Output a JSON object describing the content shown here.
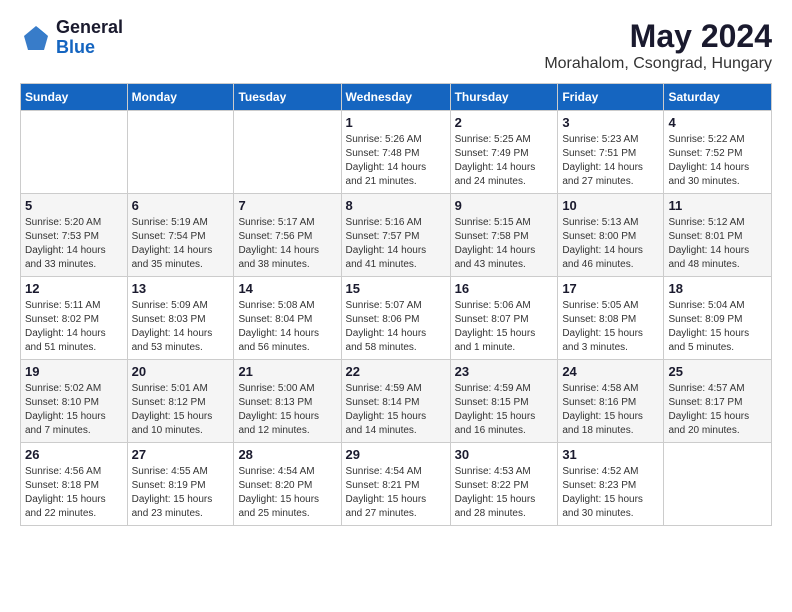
{
  "header": {
    "logo_general": "General",
    "logo_blue": "Blue",
    "title": "May 2024",
    "subtitle": "Morahalom, Csongrad, Hungary"
  },
  "days_of_week": [
    "Sunday",
    "Monday",
    "Tuesday",
    "Wednesday",
    "Thursday",
    "Friday",
    "Saturday"
  ],
  "weeks": [
    [
      {
        "day": "",
        "info": ""
      },
      {
        "day": "",
        "info": ""
      },
      {
        "day": "",
        "info": ""
      },
      {
        "day": "1",
        "info": "Sunrise: 5:26 AM\nSunset: 7:48 PM\nDaylight: 14 hours\nand 21 minutes."
      },
      {
        "day": "2",
        "info": "Sunrise: 5:25 AM\nSunset: 7:49 PM\nDaylight: 14 hours\nand 24 minutes."
      },
      {
        "day": "3",
        "info": "Sunrise: 5:23 AM\nSunset: 7:51 PM\nDaylight: 14 hours\nand 27 minutes."
      },
      {
        "day": "4",
        "info": "Sunrise: 5:22 AM\nSunset: 7:52 PM\nDaylight: 14 hours\nand 30 minutes."
      }
    ],
    [
      {
        "day": "5",
        "info": "Sunrise: 5:20 AM\nSunset: 7:53 PM\nDaylight: 14 hours\nand 33 minutes."
      },
      {
        "day": "6",
        "info": "Sunrise: 5:19 AM\nSunset: 7:54 PM\nDaylight: 14 hours\nand 35 minutes."
      },
      {
        "day": "7",
        "info": "Sunrise: 5:17 AM\nSunset: 7:56 PM\nDaylight: 14 hours\nand 38 minutes."
      },
      {
        "day": "8",
        "info": "Sunrise: 5:16 AM\nSunset: 7:57 PM\nDaylight: 14 hours\nand 41 minutes."
      },
      {
        "day": "9",
        "info": "Sunrise: 5:15 AM\nSunset: 7:58 PM\nDaylight: 14 hours\nand 43 minutes."
      },
      {
        "day": "10",
        "info": "Sunrise: 5:13 AM\nSunset: 8:00 PM\nDaylight: 14 hours\nand 46 minutes."
      },
      {
        "day": "11",
        "info": "Sunrise: 5:12 AM\nSunset: 8:01 PM\nDaylight: 14 hours\nand 48 minutes."
      }
    ],
    [
      {
        "day": "12",
        "info": "Sunrise: 5:11 AM\nSunset: 8:02 PM\nDaylight: 14 hours\nand 51 minutes."
      },
      {
        "day": "13",
        "info": "Sunrise: 5:09 AM\nSunset: 8:03 PM\nDaylight: 14 hours\nand 53 minutes."
      },
      {
        "day": "14",
        "info": "Sunrise: 5:08 AM\nSunset: 8:04 PM\nDaylight: 14 hours\nand 56 minutes."
      },
      {
        "day": "15",
        "info": "Sunrise: 5:07 AM\nSunset: 8:06 PM\nDaylight: 14 hours\nand 58 minutes."
      },
      {
        "day": "16",
        "info": "Sunrise: 5:06 AM\nSunset: 8:07 PM\nDaylight: 15 hours\nand 1 minute."
      },
      {
        "day": "17",
        "info": "Sunrise: 5:05 AM\nSunset: 8:08 PM\nDaylight: 15 hours\nand 3 minutes."
      },
      {
        "day": "18",
        "info": "Sunrise: 5:04 AM\nSunset: 8:09 PM\nDaylight: 15 hours\nand 5 minutes."
      }
    ],
    [
      {
        "day": "19",
        "info": "Sunrise: 5:02 AM\nSunset: 8:10 PM\nDaylight: 15 hours\nand 7 minutes."
      },
      {
        "day": "20",
        "info": "Sunrise: 5:01 AM\nSunset: 8:12 PM\nDaylight: 15 hours\nand 10 minutes."
      },
      {
        "day": "21",
        "info": "Sunrise: 5:00 AM\nSunset: 8:13 PM\nDaylight: 15 hours\nand 12 minutes."
      },
      {
        "day": "22",
        "info": "Sunrise: 4:59 AM\nSunset: 8:14 PM\nDaylight: 15 hours\nand 14 minutes."
      },
      {
        "day": "23",
        "info": "Sunrise: 4:59 AM\nSunset: 8:15 PM\nDaylight: 15 hours\nand 16 minutes."
      },
      {
        "day": "24",
        "info": "Sunrise: 4:58 AM\nSunset: 8:16 PM\nDaylight: 15 hours\nand 18 minutes."
      },
      {
        "day": "25",
        "info": "Sunrise: 4:57 AM\nSunset: 8:17 PM\nDaylight: 15 hours\nand 20 minutes."
      }
    ],
    [
      {
        "day": "26",
        "info": "Sunrise: 4:56 AM\nSunset: 8:18 PM\nDaylight: 15 hours\nand 22 minutes."
      },
      {
        "day": "27",
        "info": "Sunrise: 4:55 AM\nSunset: 8:19 PM\nDaylight: 15 hours\nand 23 minutes."
      },
      {
        "day": "28",
        "info": "Sunrise: 4:54 AM\nSunset: 8:20 PM\nDaylight: 15 hours\nand 25 minutes."
      },
      {
        "day": "29",
        "info": "Sunrise: 4:54 AM\nSunset: 8:21 PM\nDaylight: 15 hours\nand 27 minutes."
      },
      {
        "day": "30",
        "info": "Sunrise: 4:53 AM\nSunset: 8:22 PM\nDaylight: 15 hours\nand 28 minutes."
      },
      {
        "day": "31",
        "info": "Sunrise: 4:52 AM\nSunset: 8:23 PM\nDaylight: 15 hours\nand 30 minutes."
      },
      {
        "day": "",
        "info": ""
      }
    ]
  ]
}
